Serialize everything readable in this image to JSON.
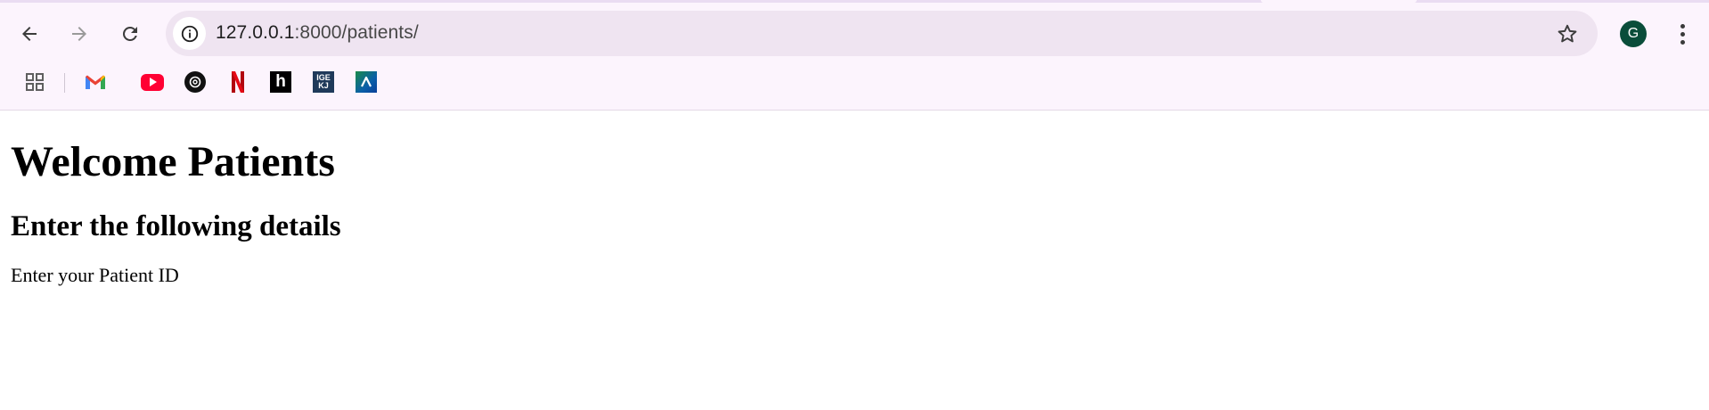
{
  "browser": {
    "url_host": "127.0.0.1",
    "url_rest": ":8000/patients/",
    "profile_initial": "G",
    "bookmarks": [
      {
        "name": "apps-icon"
      },
      {
        "name": "gmail-icon"
      },
      {
        "name": "youtube-icon"
      },
      {
        "name": "chatgpt-icon"
      },
      {
        "name": "netflix-icon"
      },
      {
        "name": "h-icon"
      },
      {
        "name": "ge-icon"
      },
      {
        "name": "a-icon"
      }
    ],
    "ge_label": "IGE KJ",
    "h_label": "h",
    "netflix_label": "N"
  },
  "page": {
    "heading": "Welcome Patients",
    "subheading": "Enter the following details",
    "prompt": "Enter your Patient ID"
  },
  "colors": {
    "chrome_bg": "#fcf4fd",
    "omnibox_bg": "#efe4f1",
    "avatar_bg": "#0a4d3a"
  }
}
